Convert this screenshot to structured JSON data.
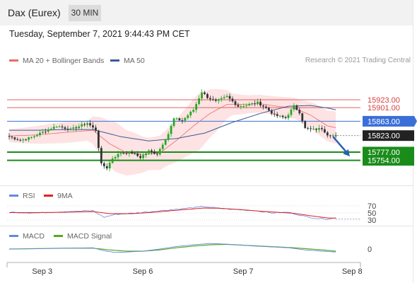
{
  "header": {
    "instrument": "Dax (Eurex)",
    "timeframe": "30 MIN",
    "timestamp": "Tuesday, September 7, 2021 9:44:43 PM CET"
  },
  "legend": {
    "ma20_label": "MA 20 + Bollinger Bands",
    "ma50_label": "MA 50",
    "credit": "Research © 2021 Trading Central"
  },
  "rsi_legend": {
    "rsi": "RSI",
    "ma": "9MA"
  },
  "macd_legend": {
    "macd": "MACD",
    "signal": "MACD Signal"
  },
  "colors": {
    "bull": "#22aa22",
    "bear": "#333333",
    "resistance": "#e06060",
    "pivot": "#3a6fd8",
    "support": "#1a8c1a",
    "ma20": "#e86a6a",
    "ma50": "#3a5a99",
    "band_fill": "#fde3e3",
    "arrow": "#2b5fb4",
    "rsi": "#6688dd",
    "rsi_ma": "#dd2222",
    "macd": "#6688dd",
    "macd_signal": "#55aa22"
  },
  "chart_data": [
    {
      "type": "candlestick",
      "title": "Dax (Eurex) 30 MIN",
      "x_tick_labels": [
        "Sep 3",
        "Sep 6",
        "Sep 7",
        "Sep 8"
      ],
      "x_tick_bars": [
        5,
        41,
        77,
        116
      ],
      "bar_count": 118,
      "ylim": [
        15692,
        16004
      ],
      "levels": [
        {
          "value": 15923.0,
          "label": "15923.00",
          "kind": "resistance"
        },
        {
          "value": 15901.0,
          "label": "15901.00",
          "kind": "resistance"
        },
        {
          "value": 15863.0,
          "label": "15863.00",
          "kind": "pivot"
        },
        {
          "value": 15823.0,
          "label": "15823.00",
          "kind": "last"
        },
        {
          "value": 15777.0,
          "label": "15777.00",
          "kind": "support"
        },
        {
          "value": 15754.0,
          "label": "15754.00",
          "kind": "support"
        }
      ],
      "forecast": {
        "from_bar": 116,
        "from": 15820,
        "to_bar": 122,
        "to": 15765
      },
      "close_anchors": [
        [
          0,
          15820
        ],
        [
          4,
          15810
        ],
        [
          8,
          15818
        ],
        [
          12,
          15833
        ],
        [
          17,
          15850
        ],
        [
          22,
          15840
        ],
        [
          28,
          15858
        ],
        [
          31,
          15838
        ],
        [
          33,
          15743
        ],
        [
          35,
          15733
        ],
        [
          37,
          15760
        ],
        [
          40,
          15775
        ],
        [
          44,
          15775
        ],
        [
          47,
          15762
        ],
        [
          50,
          15780
        ],
        [
          53,
          15772
        ],
        [
          57,
          15828
        ],
        [
          59,
          15870
        ],
        [
          62,
          15865
        ],
        [
          66,
          15895
        ],
        [
          69,
          15945
        ],
        [
          71,
          15930
        ],
        [
          74,
          15918
        ],
        [
          78,
          15932
        ],
        [
          82,
          15905
        ],
        [
          85,
          15908
        ],
        [
          89,
          15915
        ],
        [
          92,
          15900
        ],
        [
          95,
          15880
        ],
        [
          99,
          15872
        ],
        [
          102,
          15905
        ],
        [
          104,
          15888
        ],
        [
          106,
          15843
        ],
        [
          109,
          15840
        ],
        [
          112,
          15843
        ],
        [
          114,
          15826
        ],
        [
          117,
          15822
        ]
      ],
      "ma20_anchors": [
        [
          0,
          15822
        ],
        [
          10,
          15825
        ],
        [
          20,
          15832
        ],
        [
          30,
          15838
        ],
        [
          36,
          15800
        ],
        [
          42,
          15775
        ],
        [
          48,
          15770
        ],
        [
          54,
          15775
        ],
        [
          60,
          15810
        ],
        [
          66,
          15850
        ],
        [
          72,
          15885
        ],
        [
          78,
          15910
        ],
        [
          84,
          15910
        ],
        [
          90,
          15912
        ],
        [
          96,
          15905
        ],
        [
          102,
          15900
        ],
        [
          108,
          15880
        ],
        [
          114,
          15850
        ],
        [
          117,
          15845
        ]
      ],
      "band_width_anchors": [
        [
          0,
          18
        ],
        [
          10,
          25
        ],
        [
          20,
          30
        ],
        [
          28,
          28
        ],
        [
          33,
          55
        ],
        [
          38,
          70
        ],
        [
          44,
          60
        ],
        [
          50,
          45
        ],
        [
          56,
          50
        ],
        [
          62,
          65
        ],
        [
          68,
          80
        ],
        [
          74,
          60
        ],
        [
          80,
          30
        ],
        [
          86,
          25
        ],
        [
          92,
          25
        ],
        [
          98,
          28
        ],
        [
          104,
          30
        ],
        [
          110,
          40
        ],
        [
          117,
          45
        ]
      ],
      "ma50_anchors": [
        [
          0,
          15838
        ],
        [
          10,
          15838
        ],
        [
          20,
          15840
        ],
        [
          30,
          15840
        ],
        [
          40,
          15820
        ],
        [
          50,
          15808
        ],
        [
          60,
          15815
        ],
        [
          70,
          15830
        ],
        [
          80,
          15860
        ],
        [
          90,
          15885
        ],
        [
          100,
          15905
        ],
        [
          108,
          15907
        ],
        [
          114,
          15900
        ],
        [
          117,
          15895
        ]
      ]
    },
    {
      "type": "line",
      "title": "RSI",
      "ylim": [
        20,
        80
      ],
      "tick_labels": [
        {
          "value": 70,
          "label": "70"
        },
        {
          "value": 50,
          "label": "50"
        },
        {
          "value": 30,
          "label": "30"
        }
      ],
      "series": [
        {
          "name": "RSI",
          "anchors": [
            [
              0,
              52
            ],
            [
              10,
              50
            ],
            [
              20,
              54
            ],
            [
              30,
              56
            ],
            [
              34,
              38
            ],
            [
              38,
              46
            ],
            [
              44,
              49
            ],
            [
              50,
              53
            ],
            [
              56,
              58
            ],
            [
              62,
              62
            ],
            [
              70,
              68
            ],
            [
              74,
              64
            ],
            [
              80,
              60
            ],
            [
              88,
              57
            ],
            [
              94,
              50
            ],
            [
              100,
              52
            ],
            [
              106,
              40
            ],
            [
              110,
              35
            ],
            [
              114,
              33
            ],
            [
              117,
              36
            ]
          ]
        },
        {
          "name": "9MA",
          "anchors": [
            [
              0,
              51
            ],
            [
              10,
              51
            ],
            [
              20,
              52
            ],
            [
              30,
              54
            ],
            [
              36,
              48
            ],
            [
              44,
              48
            ],
            [
              50,
              51
            ],
            [
              56,
              55
            ],
            [
              62,
              59
            ],
            [
              70,
              64
            ],
            [
              76,
              63
            ],
            [
              82,
              60
            ],
            [
              90,
              55
            ],
            [
              96,
              52
            ],
            [
              102,
              49
            ],
            [
              108,
              42
            ],
            [
              114,
              36
            ],
            [
              117,
              35
            ]
          ]
        }
      ]
    },
    {
      "type": "line",
      "title": "MACD",
      "ylim": [
        -30,
        20
      ],
      "tick_labels": [
        {
          "value": 0,
          "label": "0"
        }
      ],
      "series": [
        {
          "name": "MACD",
          "anchors": [
            [
              0,
              0
            ],
            [
              10,
              1
            ],
            [
              20,
              2
            ],
            [
              30,
              3
            ],
            [
              34,
              -4
            ],
            [
              38,
              -8
            ],
            [
              42,
              -7
            ],
            [
              48,
              -5
            ],
            [
              54,
              0
            ],
            [
              60,
              6
            ],
            [
              66,
              10
            ],
            [
              72,
              13
            ],
            [
              76,
              12
            ],
            [
              82,
              10
            ],
            [
              88,
              7
            ],
            [
              94,
              5
            ],
            [
              100,
              3
            ],
            [
              106,
              -2
            ],
            [
              112,
              -5
            ],
            [
              117,
              -7
            ]
          ]
        },
        {
          "name": "MACD Signal",
          "anchors": [
            [
              0,
              0
            ],
            [
              10,
              1
            ],
            [
              20,
              2
            ],
            [
              30,
              2
            ],
            [
              36,
              -2
            ],
            [
              42,
              -5
            ],
            [
              48,
              -5
            ],
            [
              54,
              -2
            ],
            [
              60,
              3
            ],
            [
              66,
              7
            ],
            [
              72,
              10
            ],
            [
              78,
              11
            ],
            [
              84,
              9
            ],
            [
              90,
              7
            ],
            [
              96,
              5
            ],
            [
              102,
              3
            ],
            [
              108,
              0
            ],
            [
              114,
              -3
            ],
            [
              117,
              -5
            ]
          ]
        }
      ]
    }
  ]
}
